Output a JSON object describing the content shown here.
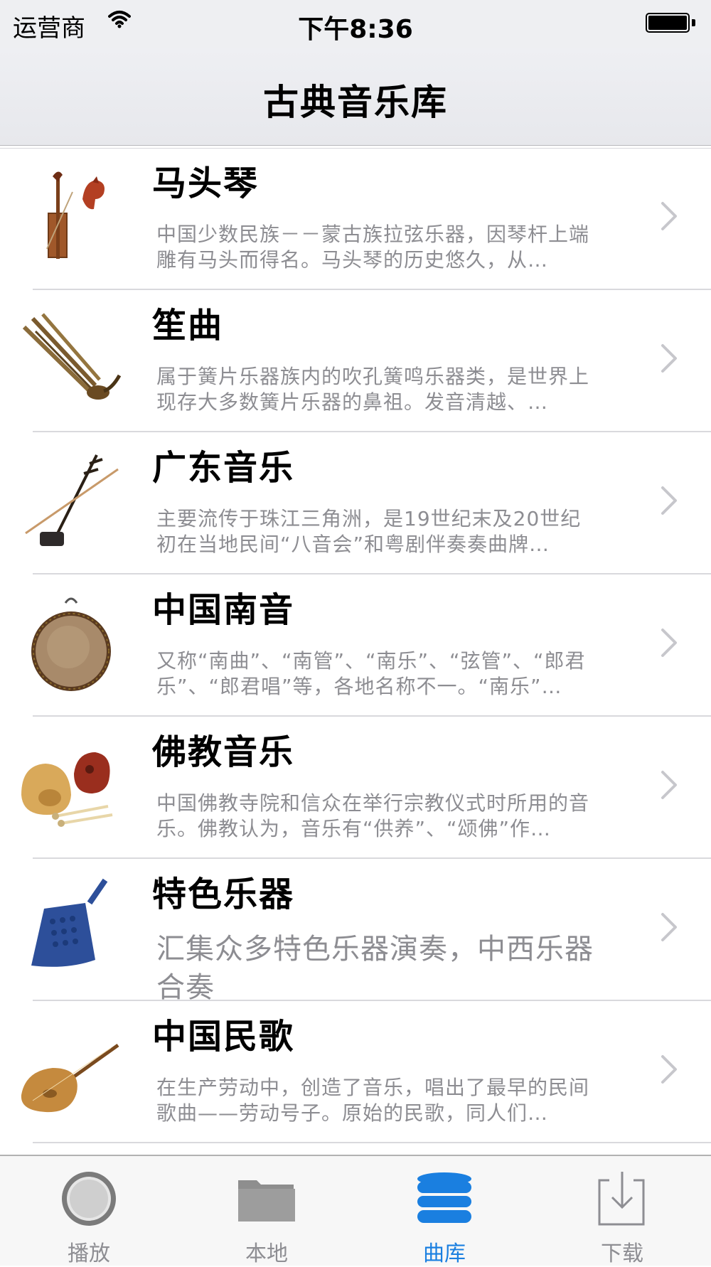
{
  "status_bar": {
    "carrier": "运营商",
    "time": "下午8:36"
  },
  "navbar": {
    "title": "古典音乐库"
  },
  "list": {
    "items": [
      {
        "title": "马头琴",
        "desc": "中国少数民族－－蒙古族拉弦乐器，因琴杆上端雕有马头而得名。马头琴的历史悠久，从…",
        "icon": "horsehead-fiddle-icon"
      },
      {
        "title": "笙曲",
        "desc": "属于簧片乐器族内的吹孔簧鸣乐器类，是世界上现存大多数簧片乐器的鼻祖。发音清越、…",
        "icon": "sheng-icon"
      },
      {
        "title": "广东音乐",
        "desc": "主要流传于珠江三角洲，是19世纪末及20世纪初在当地民间“八音会”和粤剧伴奏奏曲牌…",
        "icon": "erhu-icon"
      },
      {
        "title": "中国南音",
        "desc": "又称“南曲”、“南管”、“南乐”、“弦管”、“郎君乐”、“郎君唱”等，各地名称不一。“南乐”…",
        "icon": "drum-icon"
      },
      {
        "title": "佛教音乐",
        "desc": "中国佛教寺院和信众在举行宗教仪式时所用的音乐。佛教认为，音乐有“供养”、“颂佛”作…",
        "icon": "wooden-fish-icon"
      },
      {
        "title": "特色乐器",
        "desc": "汇集众多特色乐器演奏，中西乐器合奏",
        "icon": "bronze-bell-icon"
      },
      {
        "title": "中国民歌",
        "desc": "在生产劳动中，创造了音乐，唱出了最早的民间歌曲——劳动号子。原始的民歌，同人们…",
        "icon": "pipa-icon"
      }
    ]
  },
  "tabbar": {
    "tabs": [
      {
        "label": "播放",
        "icon": "play-disc-icon"
      },
      {
        "label": "本地",
        "icon": "folder-icon"
      },
      {
        "label": "曲库",
        "icon": "database-icon"
      },
      {
        "label": "下载",
        "icon": "download-icon"
      }
    ],
    "active_color": "#1a7fe0",
    "inactive_color": "#8e8e93"
  }
}
